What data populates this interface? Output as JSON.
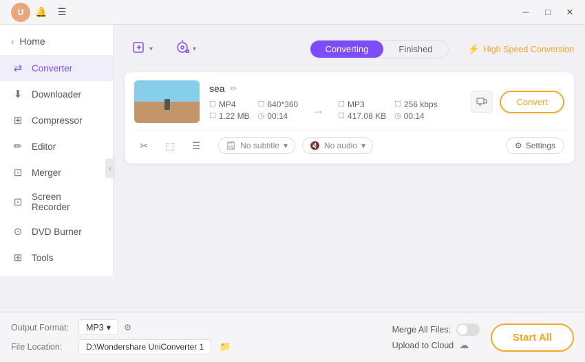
{
  "titlebar": {
    "user_initial": "U",
    "minimize_label": "─",
    "maximize_label": "□",
    "close_label": "✕"
  },
  "sidebar": {
    "home_label": "Home",
    "items": [
      {
        "id": "converter",
        "label": "Converter",
        "icon": "⇄",
        "active": true
      },
      {
        "id": "downloader",
        "label": "Downloader",
        "icon": "⬇"
      },
      {
        "id": "compressor",
        "label": "Compressor",
        "icon": "⊞"
      },
      {
        "id": "editor",
        "label": "Editor",
        "icon": "✏"
      },
      {
        "id": "merger",
        "label": "Merger",
        "icon": "⊡"
      },
      {
        "id": "screen-recorder",
        "label": "Screen Recorder",
        "icon": "⊡"
      },
      {
        "id": "dvd-burner",
        "label": "DVD Burner",
        "icon": "⊙"
      },
      {
        "id": "tools",
        "label": "Tools",
        "icon": "⊞"
      }
    ]
  },
  "toolbar": {
    "add_file_label": "Add Files",
    "add_file_chevron": "▾",
    "add_dvd_label": "",
    "add_dvd_chevron": "▾",
    "tab_converting": "Converting",
    "tab_finished": "Finished",
    "speed_label": "High Speed Conversion"
  },
  "file_card": {
    "filename": "sea",
    "source_format": "MP4",
    "source_resolution": "640*360",
    "source_size": "1.22 MB",
    "source_duration": "00:14",
    "target_format": "MP3",
    "target_bitrate": "256 kbps",
    "target_size": "417.08 KB",
    "target_duration": "00:14",
    "subtitle_label": "No subtitle",
    "audio_label": "No audio",
    "settings_label": "Settings",
    "convert_label": "Convert"
  },
  "bottom_bar": {
    "output_format_label": "Output Format:",
    "output_format_value": "MP3",
    "file_location_label": "File Location:",
    "file_location_value": "D:\\Wondershare UniConverter 1",
    "merge_files_label": "Merge All Files:",
    "upload_cloud_label": "Upload to Cloud",
    "start_all_label": "Start All"
  }
}
